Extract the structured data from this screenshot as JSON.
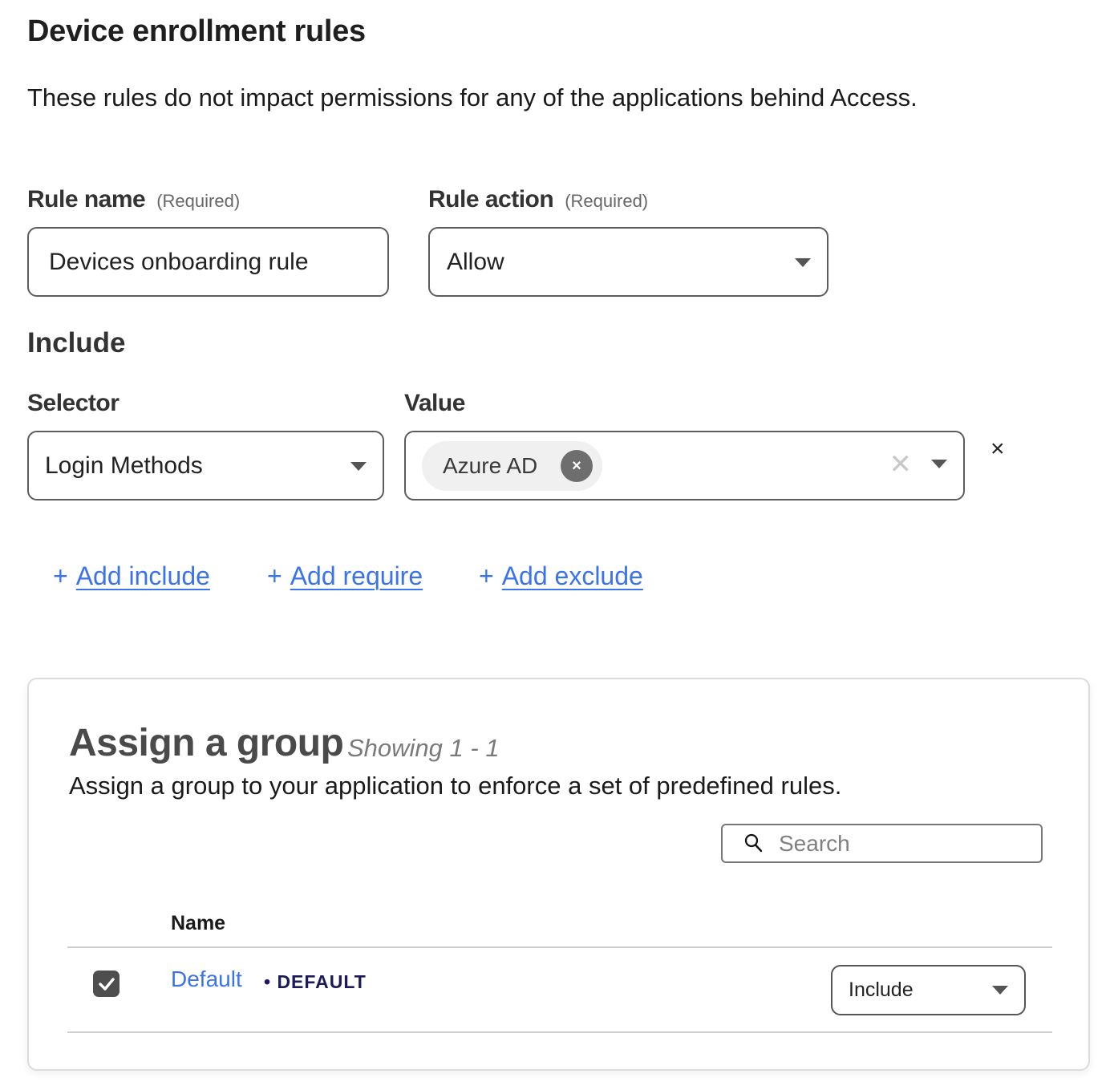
{
  "page": {
    "title": "Device enrollment rules",
    "description": "These rules do not impact permissions for any of the applications behind Access."
  },
  "rule_name": {
    "label": "Rule name",
    "required_note": "(Required)",
    "value": "Devices onboarding rule"
  },
  "rule_action": {
    "label": "Rule action",
    "required_note": "(Required)",
    "selected": "Allow"
  },
  "include": {
    "section_title": "Include",
    "selector_label": "Selector",
    "value_label": "Value",
    "selector_selected": "Login Methods",
    "value_chips": [
      "Azure AD"
    ],
    "chip_remove_glyph": "×",
    "clear_glyph": "✕",
    "remove_row_glyph": "×"
  },
  "add_links": [
    {
      "icon": "+",
      "label": "Add include"
    },
    {
      "icon": "+",
      "label": "Add require"
    },
    {
      "icon": "+",
      "label": "Add exclude"
    }
  ],
  "assign_group": {
    "title": "Assign a group",
    "showing": "Showing 1 - 1",
    "description": "Assign a group to your application to enforce a set of predefined rules.",
    "search_placeholder": "Search",
    "columns": [
      "Name"
    ],
    "rows": [
      {
        "name": "Default",
        "badge": "• DEFAULT",
        "checked": true,
        "mode": "Include"
      }
    ]
  },
  "colors": {
    "link": "#3b73e8",
    "badge": "#1e1a5a",
    "checkbox": "#4e4e4e"
  }
}
